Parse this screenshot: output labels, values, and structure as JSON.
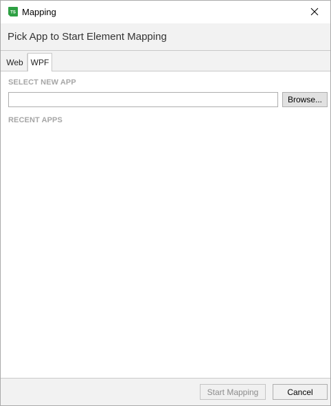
{
  "window": {
    "title": "Mapping",
    "app_icon_letters": "TS"
  },
  "header": {
    "text": "Pick App to Start Element Mapping"
  },
  "tabs": [
    {
      "label": "Web",
      "selected": false
    },
    {
      "label": "WPF",
      "selected": true
    }
  ],
  "select_app": {
    "label": "SELECT NEW APP",
    "path_value": "",
    "browse_label": "Browse..."
  },
  "recent": {
    "label": "RECENT APPS",
    "items": []
  },
  "footer": {
    "start_label": "Start Mapping",
    "cancel_label": "Cancel"
  },
  "colors": {
    "icon_green": "#2ea043",
    "section_label": "#a6a6a6"
  }
}
